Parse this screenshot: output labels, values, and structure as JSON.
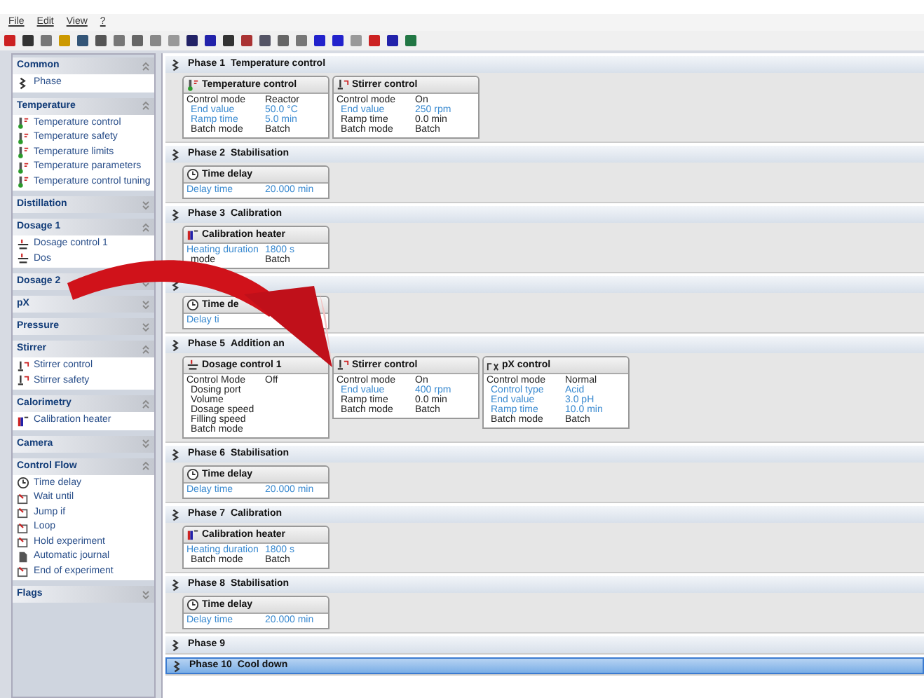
{
  "menu": [
    "File",
    "Edit",
    "View",
    "?"
  ],
  "sidebar": [
    {
      "title": "Common",
      "expanded": true,
      "items": [
        {
          "label": "Phase",
          "kind": "phase"
        }
      ]
    },
    {
      "title": "Temperature",
      "expanded": true,
      "items": [
        {
          "label": "Temperature control",
          "kind": "thermo"
        },
        {
          "label": "Temperature safety",
          "kind": "thermo"
        },
        {
          "label": "Temperature limits",
          "kind": "thermo"
        },
        {
          "label": "Temperature parameters",
          "kind": "thermo"
        },
        {
          "label": "Temperature control tuning",
          "kind": "thermo"
        }
      ]
    },
    {
      "title": "Distillation",
      "expanded": false
    },
    {
      "title": "Dosage 1",
      "expanded": true,
      "items": [
        {
          "label": "Dosage control 1",
          "kind": "dosage"
        },
        {
          "label": "Dos",
          "kind": "dosage"
        }
      ]
    },
    {
      "title": "Dosage 2",
      "expanded": false
    },
    {
      "title": "pX",
      "expanded": false
    },
    {
      "title": "Pressure",
      "expanded": false
    },
    {
      "title": "Stirrer",
      "expanded": true,
      "items": [
        {
          "label": "Stirrer control",
          "kind": "stirrer"
        },
        {
          "label": "Stirrer safety",
          "kind": "stirrer"
        }
      ]
    },
    {
      "title": "Calorimetry",
      "expanded": true,
      "items": [
        {
          "label": "Calibration heater",
          "kind": "heater"
        }
      ]
    },
    {
      "title": "Camera",
      "expanded": false
    },
    {
      "title": "Control Flow",
      "expanded": true,
      "items": [
        {
          "label": "Time delay",
          "kind": "clock"
        },
        {
          "label": "Wait until",
          "kind": "flow"
        },
        {
          "label": "Jump if",
          "kind": "flow"
        },
        {
          "label": "Loop",
          "kind": "flow"
        },
        {
          "label": "Hold experiment",
          "kind": "flow"
        },
        {
          "label": "Automatic journal",
          "kind": "doc"
        },
        {
          "label": "End of experiment",
          "kind": "flow"
        }
      ]
    },
    {
      "title": "Flags",
      "expanded": false
    }
  ],
  "phases": [
    {
      "number": "Phase 1",
      "title": "Temperature control",
      "selected": false,
      "blocks": [
        {
          "kind": "thermo",
          "title": "Temperature control",
          "rows": [
            {
              "label": "Control mode",
              "value": "Reactor",
              "modified": false
            },
            {
              "label": "End value",
              "value": "50.0 °C",
              "modified": true
            },
            {
              "label": "Ramp time",
              "value": "5.0 min",
              "modified": true
            },
            {
              "label": "Batch mode",
              "value": "Batch",
              "modified": false
            }
          ]
        },
        {
          "kind": "stirrer",
          "title": "Stirrer control",
          "rows": [
            {
              "label": "Control mode",
              "value": "On",
              "modified": false
            },
            {
              "label": "End value",
              "value": "250 rpm",
              "modified": true
            },
            {
              "label": "Ramp time",
              "value": "0.0 min",
              "modified": false
            },
            {
              "label": "Batch mode",
              "value": "Batch",
              "modified": false
            }
          ]
        }
      ]
    },
    {
      "number": "Phase 2",
      "title": "Stabilisation",
      "selected": false,
      "blocks": [
        {
          "kind": "clock",
          "title": "Time delay",
          "rows": [
            {
              "label": "Delay time",
              "value": "20.000 min",
              "modified": true
            }
          ]
        }
      ]
    },
    {
      "number": "Phase 3",
      "title": "Calibration",
      "selected": false,
      "blocks": [
        {
          "kind": "heater",
          "title": "Calibration heater",
          "rows": [
            {
              "label": "Heating duration",
              "value": "1800 s",
              "modified": true
            },
            {
              "label": "mode",
              "value": "Batch",
              "modified": false
            }
          ]
        }
      ]
    },
    {
      "selected": false,
      "blocks": [
        {
          "kind": "clock",
          "title": "Time de",
          "rows": [
            {
              "label": "Delay ti",
              "modified": true
            }
          ]
        }
      ]
    },
    {
      "number": "Phase 5",
      "title": "Addition an",
      "selected": false,
      "blocks": [
        {
          "kind": "dosage",
          "title": "Dosage control 1",
          "rows": [
            {
              "label": "Control Mode",
              "value": "Off",
              "modified": false
            },
            {
              "label": "Dosing port",
              "modified": false
            },
            {
              "label": "Volume",
              "modified": false
            },
            {
              "label": "Dosage speed",
              "modified": false
            },
            {
              "label": "Filling speed",
              "modified": false
            },
            {
              "label": "Batch mode",
              "modified": false
            }
          ]
        },
        {
          "kind": "stirrer",
          "title": "Stirrer control",
          "rows": [
            {
              "label": "Control mode",
              "value": "On",
              "modified": false
            },
            {
              "label": "End value",
              "value": "400 rpm",
              "modified": true
            },
            {
              "label": "Ramp time",
              "value": "0.0 min",
              "modified": false
            },
            {
              "label": "Batch mode",
              "value": "Batch",
              "modified": false
            }
          ]
        },
        {
          "kind": "px",
          "title": "pX control",
          "rows": [
            {
              "label": "Control mode",
              "value": "Normal",
              "modified": false
            },
            {
              "label": "Control type",
              "value": "Acid",
              "modified": true
            },
            {
              "label": "End value",
              "value": "3.0 pH",
              "modified": true
            },
            {
              "label": "Ramp time",
              "value": "10.0 min",
              "modified": true
            },
            {
              "label": "Batch mode",
              "value": "Batch",
              "modified": false
            }
          ]
        }
      ]
    },
    {
      "number": "Phase 6",
      "title": "Stabilisation",
      "selected": false,
      "blocks": [
        {
          "kind": "clock",
          "title": "Time delay",
          "rows": [
            {
              "label": "Delay time",
              "value": "20.000 min",
              "modified": true
            }
          ]
        }
      ]
    },
    {
      "number": "Phase 7",
      "title": "Calibration",
      "selected": false,
      "blocks": [
        {
          "kind": "heater",
          "title": "Calibration heater",
          "rows": [
            {
              "label": "Heating duration",
              "value": "1800 s",
              "modified": true
            },
            {
              "label": "Batch mode",
              "value": "Batch",
              "modified": false
            }
          ]
        }
      ]
    },
    {
      "number": "Phase 8",
      "title": "Stabilisation",
      "selected": false,
      "blocks": [
        {
          "kind": "clock",
          "title": "Time delay",
          "rows": [
            {
              "label": "Delay time",
              "value": "20.000 min",
              "modified": true
            }
          ]
        }
      ]
    },
    {
      "number": "Phase 9",
      "selected": false
    },
    {
      "number": "Phase 10",
      "title": "Cool down",
      "selected": true
    }
  ]
}
